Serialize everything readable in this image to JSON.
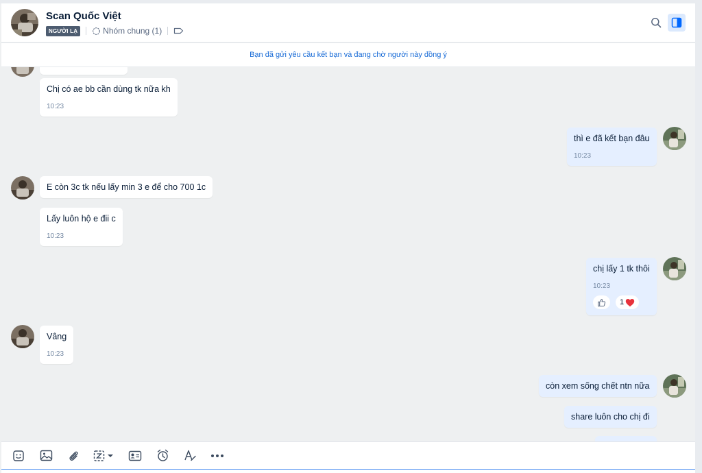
{
  "header": {
    "contact_name": "Scan Quốc Việt",
    "stranger_badge": "NGƯỜI LẠ",
    "group_label": "Nhóm chung (1)"
  },
  "notice": "Bạn đã gửi yêu cầu kết bạn và đang chờ người này đồng ý",
  "messages": [
    {
      "from": "other",
      "text": "Chị có ae bb cần dùng tk nữa kh",
      "time": "10:23"
    },
    {
      "from": "me",
      "text": "thì e đã kết bạn đâu",
      "time": "10:23"
    },
    {
      "from": "other",
      "text": "E còn 3c tk nếu lấy min 3 e để cho 700 1c",
      "time": ""
    },
    {
      "from": "other",
      "text": "Lấy luôn hộ e đii c",
      "time": "10:23"
    },
    {
      "from": "me",
      "text": "chị lấy 1 tk thôi",
      "time": "10:23",
      "reaction_count": "1"
    },
    {
      "from": "other",
      "text": "Vâng",
      "time": "10:23"
    },
    {
      "from": "me",
      "text": "còn xem sống chết ntn nữa",
      "time": ""
    },
    {
      "from": "me",
      "text": "share luôn cho chị đi",
      "time": ""
    }
  ],
  "toolbar": {
    "icons": [
      "sticker-icon",
      "image-icon",
      "attachment-icon",
      "screenshot-icon",
      "contact-card-icon",
      "reminder-icon",
      "text-format-icon",
      "more-icon"
    ]
  },
  "colors": {
    "accent": "#1569d6",
    "my_bubble": "#e5efff",
    "their_bubble": "#ffffff",
    "badge": "#4d5c70"
  }
}
